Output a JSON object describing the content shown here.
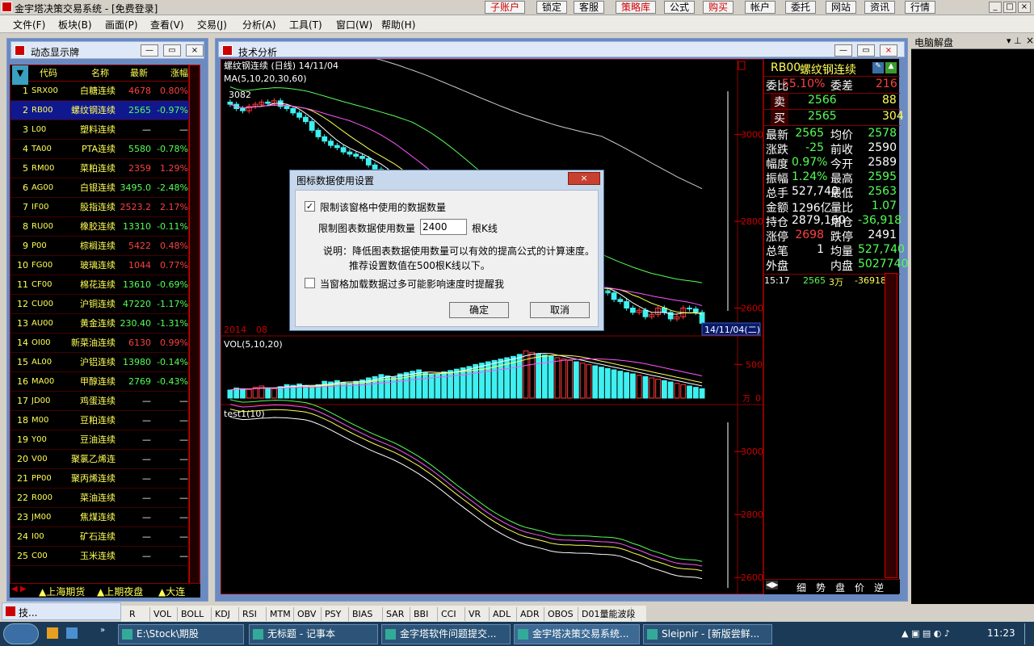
{
  "app": {
    "title": "金宇塔决策交易系统 - [免费登录]"
  },
  "top_buttons": [
    {
      "label": "子账户",
      "color": "red"
    },
    {
      "label": "锁定",
      "color": "black"
    },
    {
      "label": "客服",
      "color": "black"
    },
    {
      "label": "策略库",
      "color": "red"
    },
    {
      "label": "公式",
      "color": "black"
    },
    {
      "label": "购买",
      "color": "red"
    },
    {
      "label": "帐户",
      "color": "black"
    },
    {
      "label": "委托",
      "color": "black"
    },
    {
      "label": "网站",
      "color": "black"
    },
    {
      "label": "资讯",
      "color": "black"
    },
    {
      "label": "行情",
      "color": "black"
    }
  ],
  "menu": [
    "文件(F)",
    "板块(B)",
    "画面(P)",
    "查看(V)",
    "交易(J)",
    "分析(A)",
    "工具(T)",
    "窗口(W)",
    "帮助(H)"
  ],
  "quote_panel": {
    "title": "动态显示牌",
    "headers": [
      "",
      "代码",
      "名称",
      "最新",
      "涨幅"
    ],
    "rows": [
      {
        "n": "1",
        "code": "SRX00",
        "name": "白糖连续",
        "last": "4678",
        "chg": "0.80%"
      },
      {
        "n": "2",
        "code": "RB00",
        "name": "螺纹钢连续",
        "last": "2565",
        "chg": "-0.97%"
      },
      {
        "n": "3",
        "code": "L00",
        "name": "塑料连续",
        "last": "—",
        "chg": "—"
      },
      {
        "n": "4",
        "code": "TA00",
        "name": "PTA连续",
        "last": "5580",
        "chg": "-0.78%"
      },
      {
        "n": "5",
        "code": "RM00",
        "name": "菜粕连续",
        "last": "2359",
        "chg": "1.29%"
      },
      {
        "n": "6",
        "code": "AG00",
        "name": "白银连续",
        "last": "3495.0",
        "chg": "-2.48%"
      },
      {
        "n": "7",
        "code": "IF00",
        "name": "股指连续",
        "last": "2523.2",
        "chg": "2.17%"
      },
      {
        "n": "8",
        "code": "RU00",
        "name": "橡胶连续",
        "last": "13310",
        "chg": "-0.11%"
      },
      {
        "n": "9",
        "code": "P00",
        "name": "棕榈连续",
        "last": "5422",
        "chg": "0.48%"
      },
      {
        "n": "10",
        "code": "FG00",
        "name": "玻璃连续",
        "last": "1044",
        "chg": "0.77%"
      },
      {
        "n": "11",
        "code": "CF00",
        "name": "棉花连续",
        "last": "13610",
        "chg": "-0.69%"
      },
      {
        "n": "12",
        "code": "CU00",
        "name": "沪铜连续",
        "last": "47220",
        "chg": "-1.17%"
      },
      {
        "n": "13",
        "code": "AU00",
        "name": "黄金连续",
        "last": "230.40",
        "chg": "-1.31%"
      },
      {
        "n": "14",
        "code": "OI00",
        "name": "新菜油连续",
        "last": "6130",
        "chg": "0.99%"
      },
      {
        "n": "15",
        "code": "AL00",
        "name": "沪铝连续",
        "last": "13980",
        "chg": "-0.14%"
      },
      {
        "n": "16",
        "code": "MA00",
        "name": "甲醇连续",
        "last": "2769",
        "chg": "-0.43%"
      },
      {
        "n": "17",
        "code": "JD00",
        "name": "鸡蛋连续",
        "last": "—",
        "chg": "—"
      },
      {
        "n": "18",
        "code": "M00",
        "name": "豆粕连续",
        "last": "—",
        "chg": "—"
      },
      {
        "n": "19",
        "code": "Y00",
        "name": "豆油连续",
        "last": "—",
        "chg": "—"
      },
      {
        "n": "20",
        "code": "V00",
        "name": "聚氯乙烯连",
        "last": "—",
        "chg": "—"
      },
      {
        "n": "21",
        "code": "PP00",
        "name": "聚丙烯连续",
        "last": "—",
        "chg": "—"
      },
      {
        "n": "22",
        "code": "R000",
        "name": "菜油连续",
        "last": "—",
        "chg": "—"
      },
      {
        "n": "23",
        "code": "JM00",
        "name": "焦煤连续",
        "last": "—",
        "chg": "—"
      },
      {
        "n": "24",
        "code": "I00",
        "name": "矿石连续",
        "last": "—",
        "chg": "—"
      },
      {
        "n": "25",
        "code": "C00",
        "name": "玉米连续",
        "last": "—",
        "chg": "—"
      }
    ],
    "bottom_tabs": [
      "上海期货",
      "上期夜盘",
      "大连"
    ]
  },
  "ta_panel": {
    "title": "技术分析",
    "symbol_line": "螺纹钢连续 (日线) 14/11/04",
    "ma_label": "MA(5,10,20,30,60)",
    "high_mark": "3082",
    "price_ticks": [
      "3000",
      "2800",
      "2600"
    ],
    "date_left": "2014",
    "date_mid": "08",
    "date_right": "14/11/04(二)",
    "vol_label": "VOL(5,10,20)",
    "vol_ticks": [
      "500",
      "0"
    ],
    "vol_unit": "万",
    "ind_label": "test1(10)",
    "ind_ticks": [
      "3000",
      "2800",
      "2600"
    ],
    "colors": {
      "up": "#ff3b3b",
      "down": "#3ff0f0",
      "ma5": "#ffffff",
      "ma10": "#ffff55",
      "ma20": "#ff55ff",
      "ma30": "#55ff55",
      "ma60": "#cccccc"
    }
  },
  "right_info": {
    "code": "RB00",
    "name": "螺纹钢连续",
    "weibi_label": "委比",
    "weibi": "55.10%",
    "weicha_label": "委差",
    "weicha": "216",
    "sell_label": "卖",
    "sell_price": "2566",
    "sell_vol": "88",
    "buy_label": "买",
    "buy_price": "2565",
    "buy_vol": "304",
    "grid": [
      [
        "最新",
        "2565",
        "均价",
        "2578"
      ],
      [
        "涨跌",
        "-25",
        "前收",
        "2590"
      ],
      [
        "幅度",
        "0.97%",
        "今开",
        "2589"
      ],
      [
        "振幅",
        "1.24%",
        "最高",
        "2595"
      ],
      [
        "总手",
        "527,740",
        "最低",
        "2563"
      ],
      [
        "金额",
        "1296亿",
        "量比",
        "1.07"
      ],
      [
        "持仓",
        "2879,160",
        "增仓",
        "-36,918"
      ],
      [
        "涨停",
        "2698",
        "跌停",
        "2491"
      ],
      [
        "总笔",
        "1",
        "均量",
        "527,740"
      ],
      [
        "外盘",
        "",
        "内盘",
        "5027740"
      ]
    ],
    "tick": {
      "time": "15:17",
      "price": "2565",
      "vol": "3万",
      "chg": "-36918"
    },
    "bottom_tabs": [
      "细",
      "势",
      "盘",
      "价",
      "逆"
    ]
  },
  "jiepan": {
    "title": "电脑解盘"
  },
  "dialog": {
    "title": "图标数据使用设置",
    "check1": "限制该窗格中使用的数据数量",
    "limit_label": "限制图表数据使用数量",
    "limit_value": "2400",
    "limit_unit": "根K线",
    "note1": "说明：降低图表数据使用数量可以有效的提高公式的计算速度。",
    "note2": "推荐设置数值在500根K线以下。",
    "check2": "当窗格加载数据过多可能影响速度时提醒我",
    "ok": "确定",
    "cancel": "取消"
  },
  "indicator_tabs": [
    "R",
    "VOL",
    "BOLL",
    "KDJ",
    "RSI",
    "MTM",
    "OBV",
    "PSY",
    "BIAS",
    "SAR",
    "BBI",
    "CCI",
    "VR",
    "ADL",
    "ADR",
    "OBOS",
    "D01量能波段"
  ],
  "minimized_label": "技...",
  "taskbar": {
    "items": [
      "E:\\Stock\\期股",
      "无标题 - 记事本",
      "金字塔软件问题提交...",
      "金宇塔决策交易系统...",
      "Sleipnir - [新版尝鲜..."
    ],
    "clock": "11:23"
  },
  "chart_data": {
    "type": "candlestick",
    "symbol": "螺纹钢连续",
    "period": "日线",
    "closes": [
      3070,
      3060,
      3055,
      3065,
      3070,
      3075,
      3072,
      3078,
      3065,
      3060,
      3050,
      3040,
      3030,
      3010,
      2995,
      2985,
      2975,
      2970,
      2960,
      2955,
      2950,
      2945,
      2930,
      2920,
      2915,
      2900,
      2890,
      2870,
      2850,
      2840,
      2830,
      2810,
      2790,
      2770,
      2760,
      2740,
      2730,
      2720,
      2700,
      2690,
      2680,
      2670,
      2660,
      2655,
      2650,
      2645,
      2640,
      2650,
      2655,
      2640,
      2630,
      2625,
      2640,
      2650,
      2660,
      2645,
      2650,
      2655,
      2650,
      2640,
      2635,
      2620,
      2615,
      2600,
      2590,
      2595,
      2580,
      2585,
      2600,
      2590,
      2575,
      2580,
      2600,
      2598,
      2590,
      2565
    ],
    "volume": [
      120,
      150,
      140,
      130,
      160,
      180,
      150,
      140,
      170,
      200,
      190,
      210,
      180,
      170,
      200,
      250,
      240,
      260,
      230,
      220,
      250,
      270,
      300,
      320,
      350,
      330,
      310,
      360,
      380,
      400,
      420,
      380,
      350,
      360,
      390,
      410,
      430,
      450,
      470,
      500,
      520,
      540,
      560,
      580,
      600,
      620,
      650,
      700,
      680,
      660,
      640,
      620,
      600,
      580,
      560,
      540,
      520,
      500,
      480,
      460,
      440,
      420,
      400,
      380,
      360,
      340,
      320,
      300,
      280,
      260,
      240,
      220,
      200,
      180,
      160,
      140
    ],
    "indicator": {
      "name": "test1(10)",
      "ylim": [
        2600,
        3100
      ]
    }
  }
}
